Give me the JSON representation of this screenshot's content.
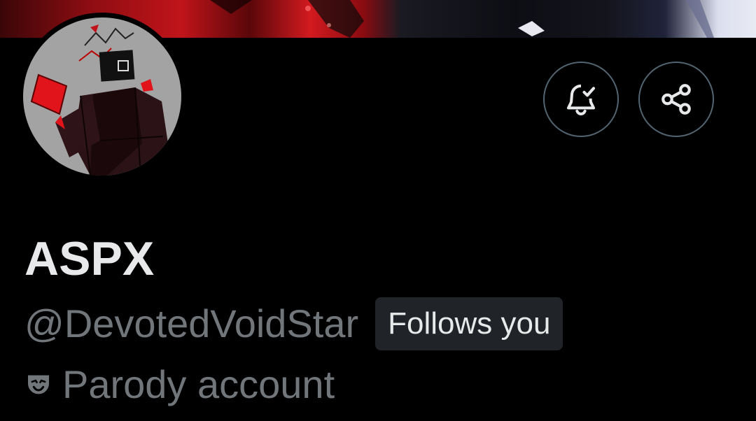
{
  "profile": {
    "display_name": "ASPX",
    "handle": "@DevotedVoidStar",
    "follows_you_label": "Follows you",
    "account_label": "Parody account",
    "account_label_icon": "theater-mask-icon"
  },
  "actions": {
    "notify_icon": "bell-check-icon",
    "share_icon": "share-icon"
  },
  "colors": {
    "background": "#000000",
    "primary_text": "#e7e9ea",
    "secondary_text": "#71767b",
    "badge_bg": "#202327",
    "button_border": "#536471",
    "accent_red": "#d21a1f"
  }
}
